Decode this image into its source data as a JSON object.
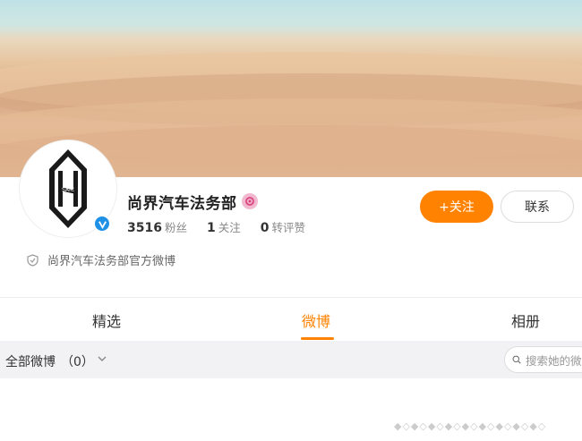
{
  "profile": {
    "name": "尚界汽车法务部",
    "avatar_logo_text": "SAIC",
    "stats": [
      {
        "num": "3516",
        "label": "粉丝"
      },
      {
        "num": "1",
        "label": "关注"
      },
      {
        "num": "0",
        "label": "转评赞"
      }
    ],
    "description": "尚界汽车法务部官方微博"
  },
  "actions": {
    "follow_label": "+关注",
    "contact_label": "联系"
  },
  "tabs": [
    {
      "label": "精选"
    },
    {
      "label": "微博"
    },
    {
      "label": "相册"
    }
  ],
  "filter": {
    "label": "全部微博",
    "count": "（0）"
  },
  "search": {
    "placeholder": "搜索她的微博"
  },
  "colors": {
    "accent": "#ff8200",
    "verified": "#1e90e6"
  }
}
